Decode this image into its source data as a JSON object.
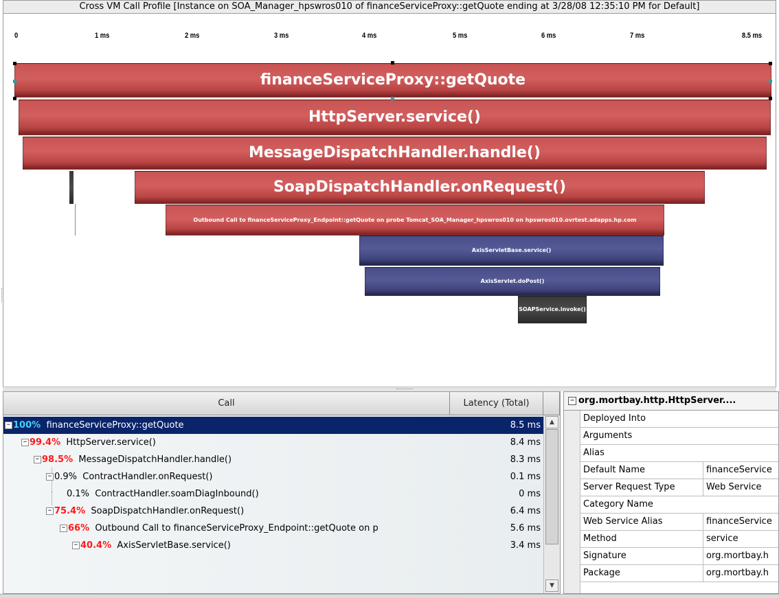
{
  "window": {
    "title": "Cross VM Call Profile [Instance on SOA_Manager_hpswros010 of financeServiceProxy::getQuote ending at 3/28/08 12:35:10 PM for Default]"
  },
  "timeline": {
    "ticks": [
      "0",
      "1 ms",
      "2 ms",
      "3 ms",
      "4 ms",
      "5 ms",
      "6 ms",
      "7 ms",
      "8.5 ms"
    ]
  },
  "bars": [
    {
      "label": "financeServiceProxy::getQuote",
      "color": "#c85454"
    },
    {
      "label": "HttpServer.service()",
      "color": "#c85454"
    },
    {
      "label": "MessageDispatchHandler.handle()",
      "color": "#c85454"
    },
    {
      "label": "SoapDispatchHandler.onRequest()",
      "color": "#c85454"
    },
    {
      "label": "Outbound Call to financeServiceProxy_Endpoint::getQuote on probe Tomcat_SOA_Manager_hpswros010 on hpswros010.ovrtest.adapps.hp.com",
      "color": "#c85454"
    },
    {
      "label": "AxisServletBase.service()",
      "color": "#4a4e88"
    },
    {
      "label": "AxisServlet.doPost()",
      "color": "#4a4e88"
    },
    {
      "label": "SOAPService.invoke()",
      "color": "#3a3a3a"
    }
  ],
  "calltree": {
    "columns": {
      "call": "Call",
      "latency": "Latency (Total)"
    },
    "rows": [
      {
        "pct": "100%",
        "name": "financeServiceProxy::getQuote",
        "latency": "8.5 ms"
      },
      {
        "pct": "99.4%",
        "name": "HttpServer.service()",
        "latency": "8.4 ms"
      },
      {
        "pct": "98.5%",
        "name": "MessageDispatchHandler.handle()",
        "latency": "8.3 ms"
      },
      {
        "pct": "0.9%",
        "name": "ContractHandler.onRequest()",
        "latency": "0.1 ms"
      },
      {
        "pct": "0.1%",
        "name": "ContractHandler.soamDiagInbound()",
        "latency": "0 ms"
      },
      {
        "pct": "75.4%",
        "name": "SoapDispatchHandler.onRequest()",
        "latency": "6.4 ms"
      },
      {
        "pct": "66%",
        "name": "Outbound Call to financeServiceProxy_Endpoint::getQuote on p",
        "latency": "5.6 ms"
      },
      {
        "pct": "40.4%",
        "name": "AxisServletBase.service()",
        "latency": "3.4 ms"
      }
    ]
  },
  "properties": {
    "header": "org.mortbay.http.HttpServer....",
    "rows": [
      {
        "key": "Deployed Into",
        "value": ""
      },
      {
        "key": "Arguments",
        "value": ""
      },
      {
        "key": "Alias",
        "value": ""
      },
      {
        "key": "Default Name",
        "value": "financeService"
      },
      {
        "key": "Server Request Type",
        "value": "Web Service"
      },
      {
        "key": "Category Name",
        "value": ""
      },
      {
        "key": "Web Service Alias",
        "value": "financeService"
      },
      {
        "key": "Method",
        "value": "service"
      },
      {
        "key": "Signature",
        "value": "org.mortbay.h"
      },
      {
        "key": "Package",
        "value": "org.mortbay.h"
      }
    ]
  }
}
